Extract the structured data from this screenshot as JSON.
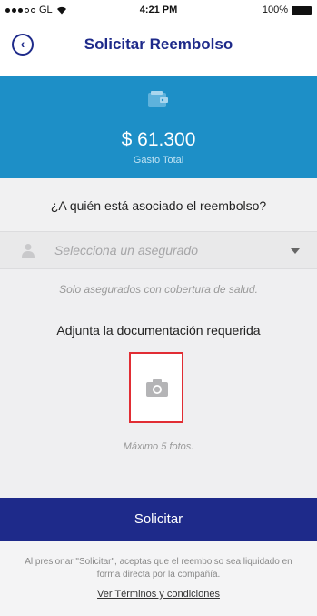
{
  "status_bar": {
    "carrier": "GL",
    "time": "4:21 PM",
    "battery": "100%"
  },
  "nav": {
    "title": "Solicitar Reembolso",
    "back_icon": "chevron-left-circle-icon"
  },
  "summary": {
    "amount": "$ 61.300",
    "label": "Gasto Total",
    "icon": "wallet-icon"
  },
  "question": "¿A quién está asociado el reembolso?",
  "insured_select": {
    "placeholder": "Selecciona un asegurado",
    "icon": "user-icon"
  },
  "note": "Solo asegurados con cobertura de salud.",
  "attach": {
    "title": "Adjunta la documentación requerida",
    "max_label": "Máximo 5 fotos.",
    "icon": "camera-icon"
  },
  "submit_label": "Solicitar",
  "terms": {
    "text": "Al presionar \"Solicitar\", aceptas que el reembolso sea liquidado en forma directa por la compañía.",
    "link": "Ver Términos y condiciones"
  },
  "colors": {
    "brand": "#1e2a8a",
    "hero": "#1d8fc7",
    "highlight": "#e12d34"
  }
}
